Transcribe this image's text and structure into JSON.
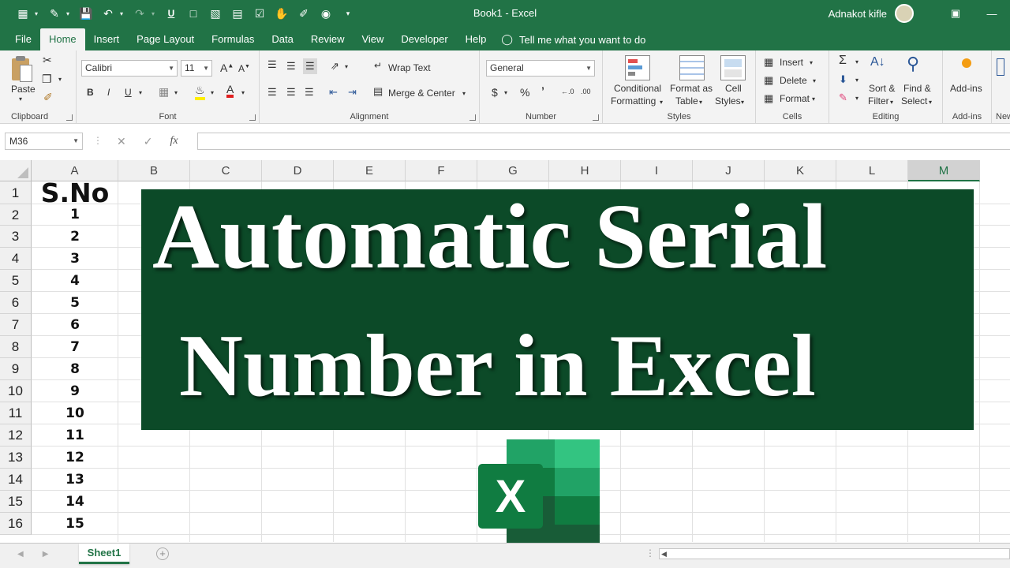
{
  "app": {
    "document_title": "Book1  -  Excel",
    "user_name": "Adnakot kifle"
  },
  "menu_tabs": [
    "File",
    "Home",
    "Insert",
    "Page Layout",
    "Formulas",
    "Data",
    "Review",
    "View",
    "Developer",
    "Help"
  ],
  "active_tab": "Home",
  "tell_me": "Tell me what you want to do",
  "ribbon": {
    "clipboard": {
      "label": "Clipboard",
      "paste": "Paste"
    },
    "font": {
      "label": "Font",
      "font_name": "Calibri",
      "font_size": "11",
      "bold": "B",
      "italic": "I",
      "underline": "U"
    },
    "alignment": {
      "label": "Alignment",
      "wrap_text": "Wrap Text",
      "merge_center": "Merge & Center"
    },
    "number": {
      "label": "Number",
      "format": "General",
      "currency": "$",
      "percent": "%",
      "comma": "’"
    },
    "styles": {
      "label": "Styles",
      "conditional_1": "Conditional",
      "conditional_2": "Formatting",
      "format_table_1": "Format as",
      "format_table_2": "Table",
      "cell_styles_1": "Cell",
      "cell_styles_2": "Styles"
    },
    "cells": {
      "label": "Cells",
      "insert": "Insert",
      "delete": "Delete",
      "format": "Format"
    },
    "editing": {
      "label": "Editing",
      "sort_1": "Sort &",
      "sort_2": "Filter",
      "find_1": "Find &",
      "find_2": "Select"
    },
    "addins": {
      "label": "Add-ins",
      "button": "Add-ins"
    },
    "new": {
      "label": "New"
    }
  },
  "formula_bar": {
    "name_box": "M36",
    "fx": "fx",
    "value": ""
  },
  "columns": [
    "A",
    "B",
    "C",
    "D",
    "E",
    "F",
    "G",
    "H",
    "I",
    "J",
    "K",
    "L",
    "M"
  ],
  "selected_column": "M",
  "rows": [
    "1",
    "2",
    "3",
    "4",
    "5",
    "6",
    "7",
    "8",
    "9",
    "10",
    "11",
    "12",
    "13",
    "14",
    "15",
    "16"
  ],
  "column_a_values": [
    "S.No",
    "1",
    "2",
    "3",
    "4",
    "5",
    "6",
    "7",
    "8",
    "9",
    "10",
    "11",
    "12",
    "13",
    "14",
    "15"
  ],
  "banner": {
    "line1": "Automatic Serial",
    "line2": "Number in Excel"
  },
  "colors": {
    "excel_green": "#217346",
    "banner_bg": "#0c4a28"
  },
  "sheet_tabs": [
    "Sheet1"
  ]
}
